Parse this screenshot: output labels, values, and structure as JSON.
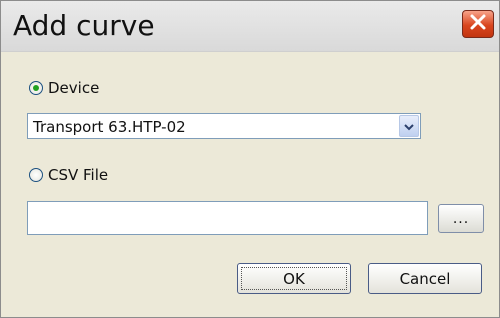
{
  "dialog": {
    "title": "Add curve"
  },
  "device_option": {
    "label": "Device",
    "selected": true,
    "select_value": "Transport 63.HTP-02"
  },
  "csv_option": {
    "label": "CSV File",
    "selected": false,
    "file_path": "",
    "browse_label": "..."
  },
  "buttons": {
    "ok_label": "OK",
    "cancel_label": "Cancel"
  },
  "colors": {
    "close_button": "#d9461f",
    "radio_dot": "#21a121",
    "dialog_background": "#ece9d8"
  }
}
